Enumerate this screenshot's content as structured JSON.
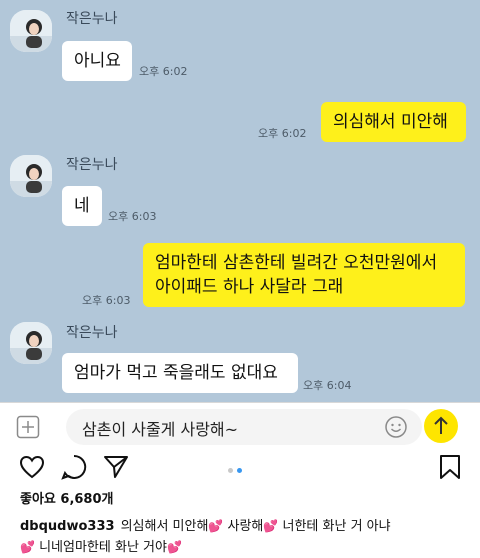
{
  "chat": {
    "sender": "작은누나",
    "messages": [
      {
        "dir": "in",
        "text": "아니요",
        "time": "오후 6:02"
      },
      {
        "dir": "out",
        "text": "의심해서 미안해",
        "time": "오후 6:02"
      },
      {
        "dir": "in",
        "text": "네",
        "time": "오후 6:03"
      },
      {
        "dir": "out",
        "line1": "엄마한테 삼촌한테 빌려간 오천만원에서",
        "line2": "아이패드 하나 사달라 그래",
        "time": "오후 6:03"
      },
      {
        "dir": "in",
        "text": "엄마가 먹고 죽을래도 없대요",
        "time": "오후 6:04"
      }
    ]
  },
  "input": {
    "draft": "삼촌이 사줄게 사랑해~"
  },
  "post": {
    "likes": "좋아요 6,680개",
    "username": "dbqudwo333",
    "caption_1": "의심해서 미안해",
    "caption_2": "사랑해",
    "caption_3": "너한테 화난 거 아냐",
    "caption_4": "니네엄마한테 화난 거야",
    "heart_glyph": "💕",
    "carousel": {
      "count": 2,
      "active": 2
    }
  },
  "colors": {
    "chat_bg": "#b2c7d9",
    "outgoing_bubble": "#fef01b",
    "incoming_bubble": "#ffffff",
    "send_button": "#fee500",
    "heart": "#ff3ea5",
    "active_dot": "#3897f0"
  },
  "icons": [
    "plus-icon",
    "emoji-icon",
    "send-arrow-icon",
    "heart-icon",
    "comment-icon",
    "share-icon",
    "bookmark-icon"
  ]
}
